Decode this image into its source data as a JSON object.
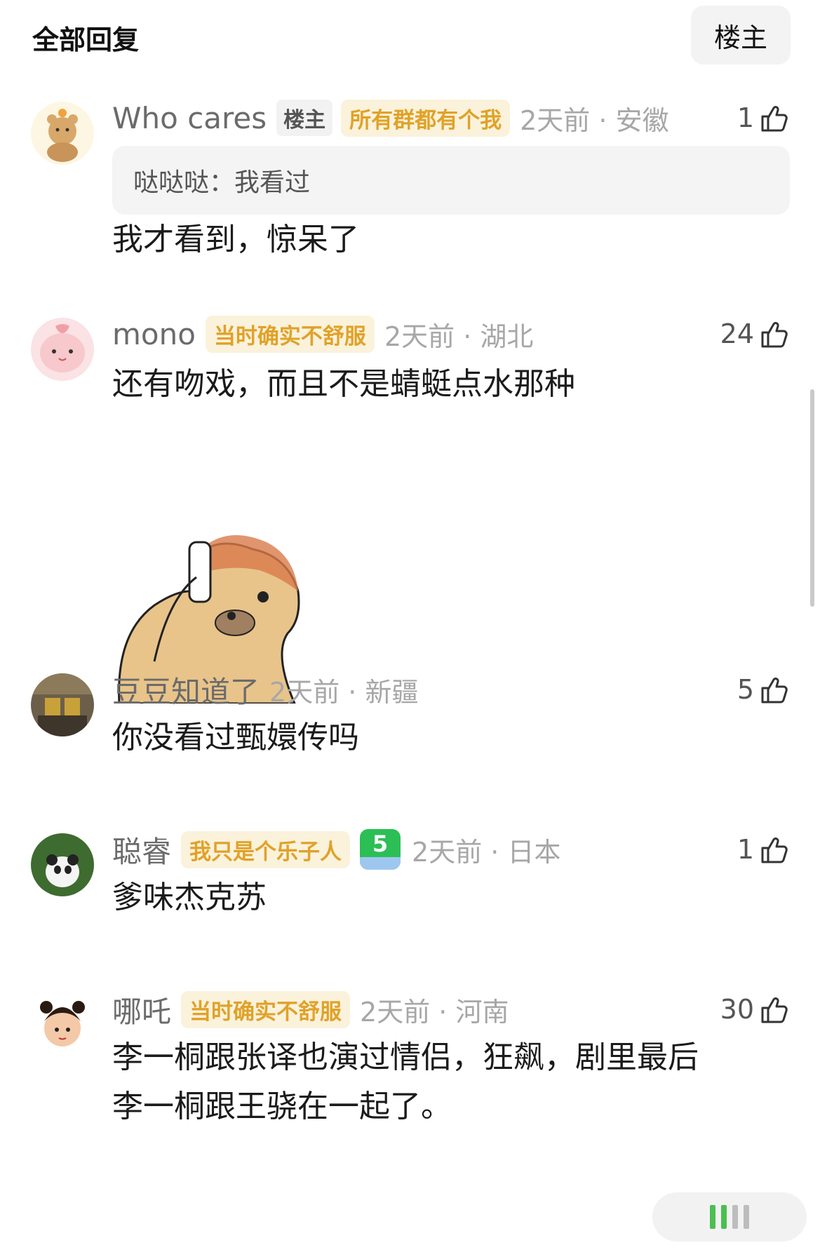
{
  "header": {
    "title": "全部回复",
    "op_filter_label": "楼主"
  },
  "comments": [
    {
      "username": "Who cares",
      "op_badge": "楼主",
      "tag": "所有群都有个我",
      "time": "2天前",
      "location": "安徽",
      "likes": "1",
      "quote_author": "哒哒哒：",
      "quote_text": "我看过",
      "text": "我才看到，惊呆了"
    },
    {
      "username": "mono",
      "tag": "当时确实不舒服",
      "time": "2天前",
      "location": "湖北",
      "likes": "24",
      "text": "还有吻戏，而且不是蜻蜓点水那种"
    },
    {
      "username": "豆豆知道了",
      "time": "2天前",
      "location": "新疆",
      "likes": "5",
      "text": "你没看过甄嬛传吗"
    },
    {
      "username": "聪睿",
      "tag": "我只是个乐子人",
      "level": "5",
      "time": "2天前",
      "location": "日本",
      "likes": "1",
      "text": "爹味杰克苏"
    },
    {
      "username": "哪吒",
      "tag": "当时确实不舒服",
      "time": "2天前",
      "location": "河南",
      "likes": "30",
      "text_line1": "李一桐跟张译也演过情侣，狂飙，剧里最后",
      "text_line2": "李一桐跟王骁在一起了。"
    }
  ],
  "separator": "·",
  "colors": {
    "tag_text": "#e0a228",
    "tag_bg": "#fbf2dc",
    "meta_gray": "#a7a7a7",
    "level_green": "#2bbf55"
  },
  "icons": {
    "like": "thumbs-up-icon"
  }
}
